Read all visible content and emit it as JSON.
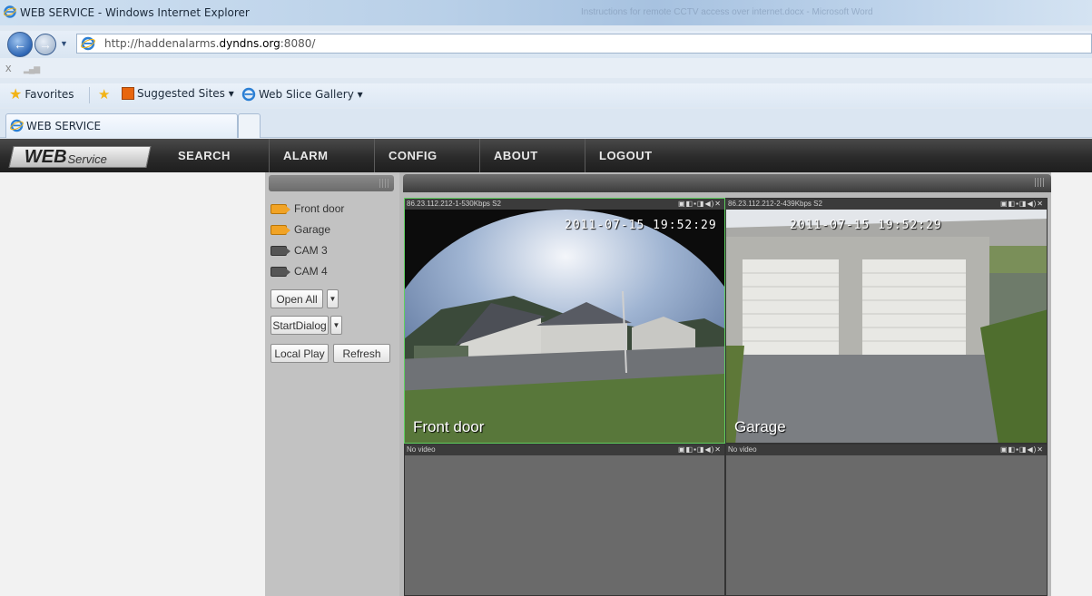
{
  "browser": {
    "window_title": "WEB SERVICE - Windows Internet Explorer",
    "background_window_title": "Instructions for remote CCTV access over internet.docx - Microsoft Word",
    "url_prefix": "http://haddenalarms.",
    "url_domain": "dyndns.org",
    "url_suffix": ":8080/",
    "cmd_close": "x",
    "favorites": {
      "favorites_label": "Favorites",
      "suggested_sites": "Suggested Sites ▾",
      "web_slice_gallery": "Web Slice Gallery ▾"
    },
    "tab_title": "WEB SERVICE"
  },
  "app": {
    "logo_main": "WEB",
    "logo_sub": "Service",
    "menu": [
      "SEARCH",
      "ALARM",
      "CONFIG",
      "ABOUT",
      "LOGOUT"
    ],
    "cameras": [
      {
        "label": "Front door",
        "state": "active"
      },
      {
        "label": "Garage",
        "state": "active"
      },
      {
        "label": "CAM 3",
        "state": "inactive"
      },
      {
        "label": "CAM 4",
        "state": "inactive"
      }
    ],
    "buttons": {
      "open_all": "Open All",
      "start_dialog": "StartDialog",
      "local_play": "Local Play",
      "refresh": "Refresh",
      "dropdown_glyph": "▼"
    },
    "panes": [
      {
        "info": "86.23.112.212-1-530Kbps S2",
        "timestamp": "2011-07-15 19:52:29",
        "name": "Front door"
      },
      {
        "info": "86.23.112.212-2-439Kbps S2",
        "timestamp": "2011-07-15 19:52:29",
        "name": "Garage"
      },
      {
        "info": "No video",
        "timestamp": "",
        "name": ""
      },
      {
        "info": "No video",
        "timestamp": "",
        "name": ""
      }
    ],
    "pane_tools": "▣◧▪◨◀)✕"
  }
}
